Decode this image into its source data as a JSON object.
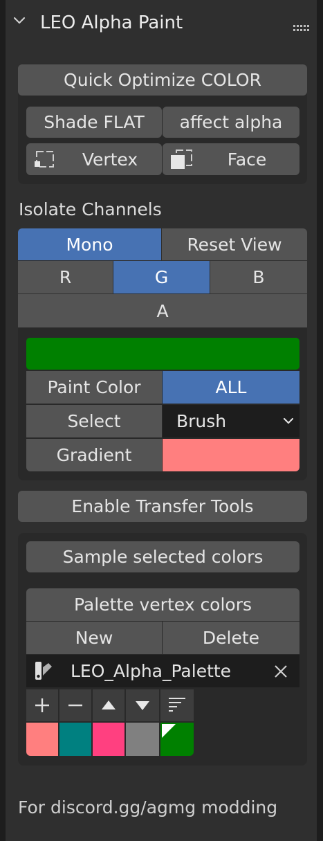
{
  "panel": {
    "title": "LEO Alpha Paint"
  },
  "optimize": {
    "quick_optimize_label": "Quick Optimize COLOR",
    "shade_flat_label": "Shade FLAT",
    "affect_alpha_label": "affect alpha",
    "vertex_label": "Vertex",
    "face_label": "Face"
  },
  "isolate": {
    "heading": "Isolate Channels",
    "mono_label": "Mono",
    "reset_view_label": "Reset View",
    "r_label": "R",
    "g_label": "G",
    "b_label": "B",
    "a_label": "A"
  },
  "paint": {
    "color_swatch_hex": "#008000",
    "paint_color_label": "Paint Color",
    "paint_color_value": "ALL",
    "select_label": "Select",
    "select_value": "Brush",
    "gradient_label": "Gradient",
    "gradient_hex": "#ff7f7f"
  },
  "transfer": {
    "enable_label": "Enable Transfer Tools",
    "sample_label": "Sample selected colors",
    "palette_header": "Palette vertex colors",
    "new_label": "New",
    "delete_label": "Delete",
    "palette_name": "LEO_Alpha_Palette",
    "palette_colors": [
      "#ff7f7f",
      "#008080",
      "#ff4080",
      "#808080",
      "#008000"
    ]
  },
  "footer": {
    "text": "For discord.gg/agmg modding"
  },
  "colors": {
    "accent_blue": "#4772b3",
    "button_gray": "#545454",
    "panel_bg": "#2f2f2f"
  }
}
